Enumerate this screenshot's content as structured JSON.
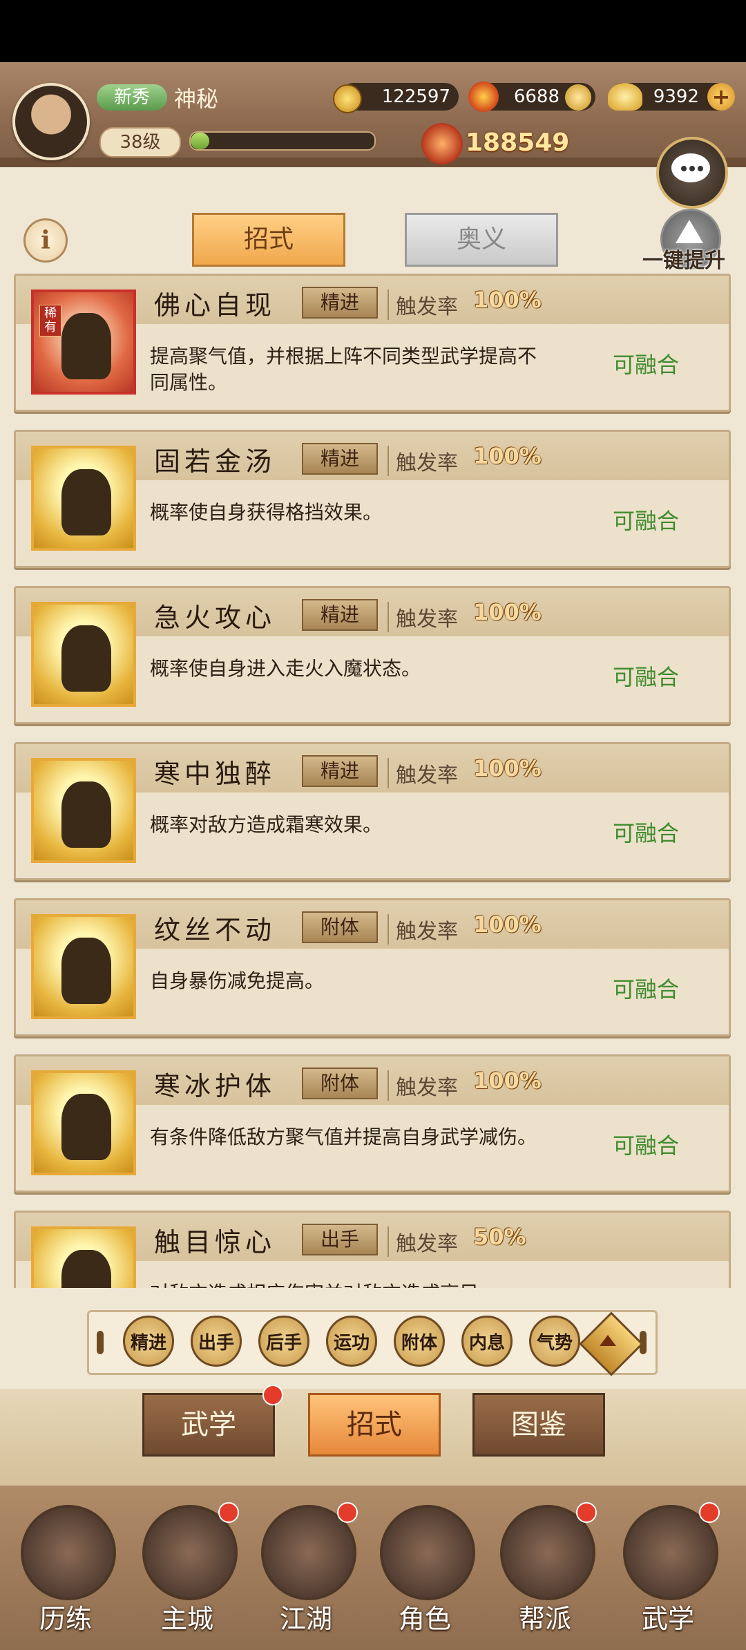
{
  "header": {
    "rank": "新秀",
    "player_name": "神秘",
    "level": "38级",
    "exp_fraction": 0.1,
    "copper": "122597",
    "fire": "6688",
    "gold": "9392",
    "power": "188549"
  },
  "tabs": {
    "zhaoshi": "招式",
    "aoyi": "奥义"
  },
  "upgrade_label": "一键提升",
  "skills": [
    {
      "name": "佛心自现",
      "type": "精进",
      "trigger_label": "触发率",
      "trigger_rate": "100%",
      "desc": "提高聚气值，并根据上阵不同类型武学提高不同属性。",
      "fuse": "可融合",
      "rarity": "稀有"
    },
    {
      "name": "固若金汤",
      "type": "精进",
      "trigger_label": "触发率",
      "trigger_rate": "100%",
      "desc": "概率使自身获得格挡效果。",
      "fuse": "可融合"
    },
    {
      "name": "急火攻心",
      "type": "精进",
      "trigger_label": "触发率",
      "trigger_rate": "100%",
      "desc": "概率使自身进入走火入魔状态。",
      "fuse": "可融合"
    },
    {
      "name": "寒中独醉",
      "type": "精进",
      "trigger_label": "触发率",
      "trigger_rate": "100%",
      "desc": "概率对敌方造成霜寒效果。",
      "fuse": "可融合"
    },
    {
      "name": "纹丝不动",
      "type": "附体",
      "trigger_label": "触发率",
      "trigger_rate": "100%",
      "desc": "自身暴伤减免提高。",
      "fuse": "可融合"
    },
    {
      "name": "寒冰护体",
      "type": "附体",
      "trigger_label": "触发率",
      "trigger_rate": "100%",
      "desc": "有条件降低敌方聚气值并提高自身武学减伤。",
      "fuse": "可融合"
    },
    {
      "name": "触目惊心",
      "type": "出手",
      "trigger_label": "触发率",
      "trigger_rate": "50%",
      "desc": "对敌方造成相应伤害并对敌方造成高目",
      "fuse": ""
    }
  ],
  "filters": [
    "精进",
    "出手",
    "后手",
    "运功",
    "附体",
    "内息",
    "气势"
  ],
  "subtabs": [
    "武学",
    "招式",
    "图鉴"
  ],
  "nav": [
    "历练",
    "主城",
    "江湖",
    "角色",
    "帮派",
    "武学"
  ]
}
